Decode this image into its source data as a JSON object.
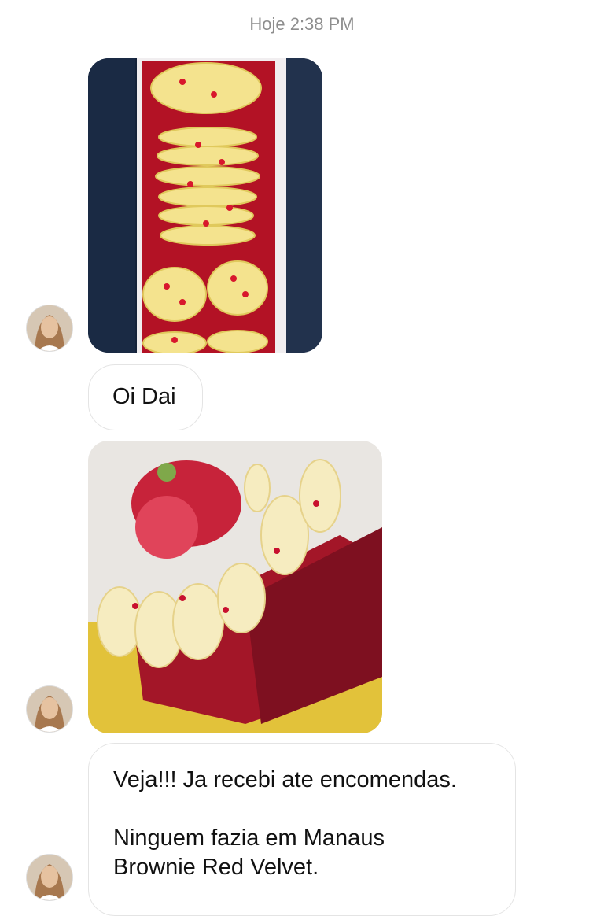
{
  "thread": {
    "timestamp": "Hoje 2:38 PM",
    "messages": [
      {
        "type": "image",
        "alt": "red velvet brownies box",
        "avatar_icon": "profile-avatar-icon"
      },
      {
        "type": "text",
        "text": "Oi Dai"
      },
      {
        "type": "image",
        "alt": "red velvet brownie slice",
        "avatar_icon": "profile-avatar-icon"
      },
      {
        "type": "text",
        "lines": [
          "Veja!!! Ja recebi ate encomendas.",
          "",
          "Ninguem fazia em Manaus",
          "Brownie Red Velvet."
        ]
      }
    ]
  },
  "colors": {
    "bubble_border": "#e4e4e4",
    "timestamp": "#8e8e8e",
    "text": "#111111"
  }
}
